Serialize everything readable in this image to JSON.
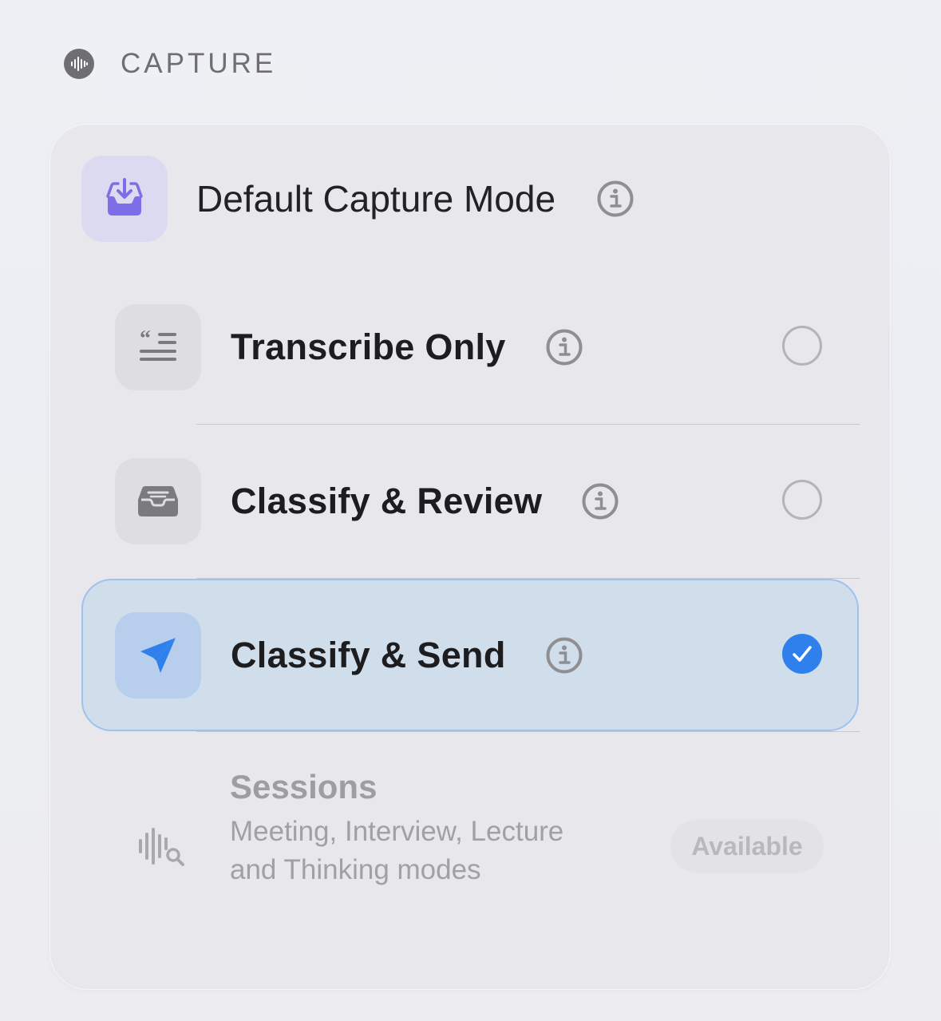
{
  "section": {
    "title": "CAPTURE",
    "icon": "waveform-icon"
  },
  "mode": {
    "title": "Default Capture Mode",
    "icon": "tray-download-icon",
    "info_icon": "info-icon"
  },
  "options": [
    {
      "label": "Transcribe Only",
      "icon": "quote-lines-icon",
      "selected": false
    },
    {
      "label": "Classify & Review",
      "icon": "tray-icon",
      "selected": false
    },
    {
      "label": "Classify & Send",
      "icon": "paper-plane-icon",
      "selected": true
    }
  ],
  "sessions": {
    "title": "Sessions",
    "description": "Meeting, Interview, Lecture and Thinking modes",
    "badge": "Available",
    "icon": "waveform-search-icon"
  },
  "colors": {
    "accent": "#2f80ed",
    "purple_icon": "#7c6ee6",
    "selected_bg": "#d0ddeb"
  }
}
